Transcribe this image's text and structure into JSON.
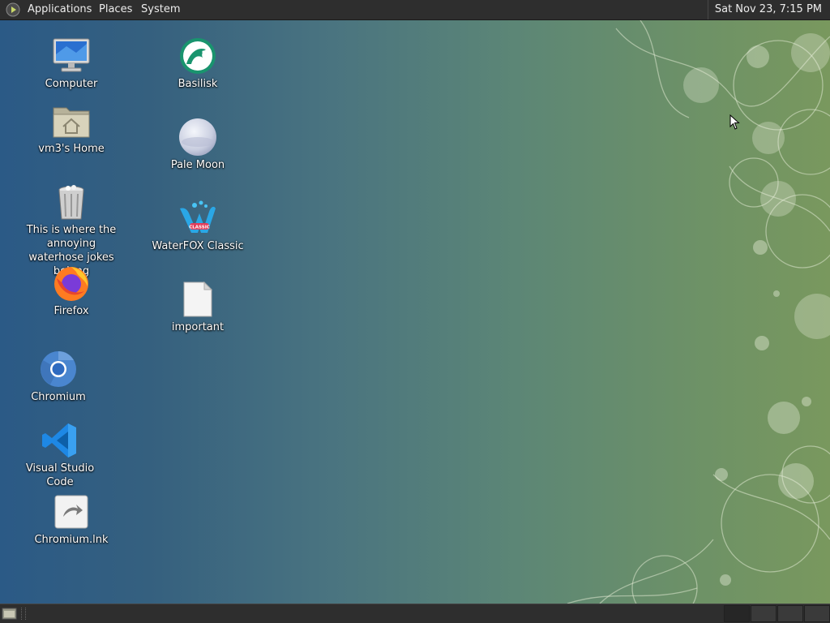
{
  "top_panel": {
    "menus": [
      "Applications",
      "Places",
      "System"
    ],
    "clock": "Sat Nov 23,  7:15 PM"
  },
  "desktop": {
    "icons": [
      {
        "label": "Computer",
        "icon": "computer-icon"
      },
      {
        "label": "vm3's Home",
        "icon": "home-folder-icon"
      },
      {
        "label": "This is where the annoying waterhose jokes belong",
        "icon": "trash-icon"
      },
      {
        "label": "Firefox",
        "icon": "firefox-icon"
      },
      {
        "label": "Chromium",
        "icon": "chromium-icon"
      },
      {
        "label": "Visual Studio Code",
        "icon": "vscode-icon"
      },
      {
        "label": "Chromium.lnk",
        "icon": "shortcut-icon"
      },
      {
        "label": "Basilisk",
        "icon": "basilisk-icon"
      },
      {
        "label": "Pale Moon",
        "icon": "pale-moon-icon"
      },
      {
        "label": "WaterFOX Classic",
        "icon": "waterfox-icon"
      },
      {
        "label": "important",
        "icon": "document-icon"
      }
    ]
  },
  "waterfox_badge": "CLASSIC",
  "colors": {
    "panel": "#2e2e2e",
    "desktop_left": "#2b5a86",
    "desktop_right": "#79985e"
  }
}
